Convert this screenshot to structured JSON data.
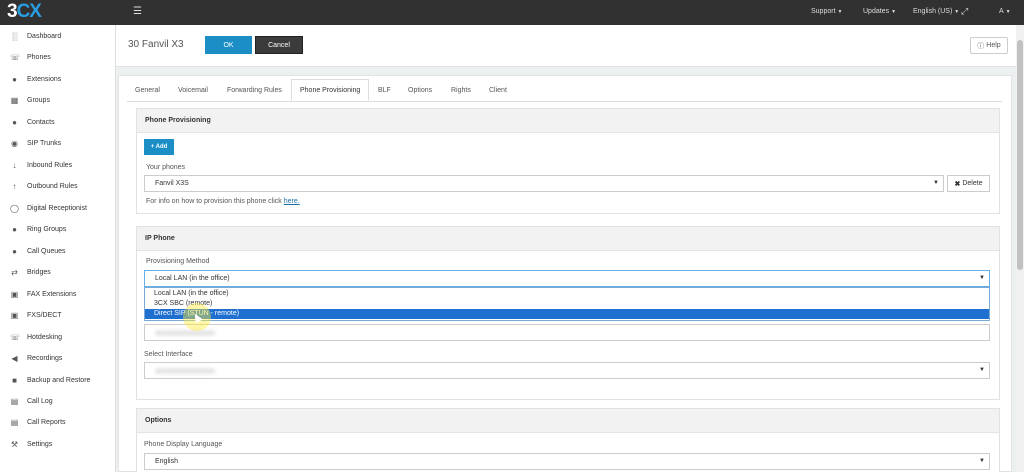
{
  "brand": {
    "logo_3": "3",
    "logo_cx": "CX"
  },
  "topbar": {
    "support": "Support",
    "updates": "Updates",
    "language": "English (US)",
    "user": "A"
  },
  "sidebar": {
    "items": [
      {
        "label": "Dashboard",
        "icon": "bar-chart-icon"
      },
      {
        "label": "Phones",
        "icon": "phone-icon"
      },
      {
        "label": "Extensions",
        "icon": "user-icon"
      },
      {
        "label": "Groups",
        "icon": "grid-icon"
      },
      {
        "label": "Contacts",
        "icon": "user-icon"
      },
      {
        "label": "SIP Trunks",
        "icon": "globe-icon"
      },
      {
        "label": "Inbound Rules",
        "icon": "arrow-down-icon"
      },
      {
        "label": "Outbound Rules",
        "icon": "arrow-up-icon"
      },
      {
        "label": "Digital Receptionist",
        "icon": "headset-icon"
      },
      {
        "label": "Ring Groups",
        "icon": "users-icon"
      },
      {
        "label": "Call Queues",
        "icon": "users-icon"
      },
      {
        "label": "Bridges",
        "icon": "exchange-icon"
      },
      {
        "label": "FAX Extensions",
        "icon": "fax-icon"
      },
      {
        "label": "FXS/DECT",
        "icon": "fax-icon"
      },
      {
        "label": "Hotdesking",
        "icon": "phone-icon"
      },
      {
        "label": "Recordings",
        "icon": "volume-icon"
      },
      {
        "label": "Backup and Restore",
        "icon": "truck-icon"
      },
      {
        "label": "Call Log",
        "icon": "book-icon"
      },
      {
        "label": "Call Reports",
        "icon": "book-icon"
      },
      {
        "label": "Settings",
        "icon": "wrench-icon"
      }
    ]
  },
  "header": {
    "title": "30 Fanvil X3",
    "ok_label": "OK",
    "cancel_label": "Cancel",
    "help_label": "Help"
  },
  "tabs": [
    "General",
    "Voicemail",
    "Forwarding Rules",
    "Phone Provisioning",
    "BLF",
    "Options",
    "Rights",
    "Client"
  ],
  "phone_provisioning": {
    "title": "Phone Provisioning",
    "add_label": "+ Add",
    "your_phones_label": "Your phones",
    "selected_phone": "Fanvil X3S",
    "delete_label": "Delete",
    "info_text": "For info on how to provision this phone click",
    "info_link": "here."
  },
  "ip_phone": {
    "title": "IP Phone",
    "method_label": "Provisioning Method",
    "method_value": "Local LAN (in the office)",
    "options": [
      "Local LAN (in the office)",
      "3CX SBC (remote)",
      "Direct SIP (STUN - remote)"
    ],
    "selected_option": "Direct SIP (STUN - remote)",
    "interface_label": "Select Interface"
  },
  "options_panel": {
    "title": "Options",
    "language_label": "Phone Display Language",
    "language_value": "English"
  }
}
